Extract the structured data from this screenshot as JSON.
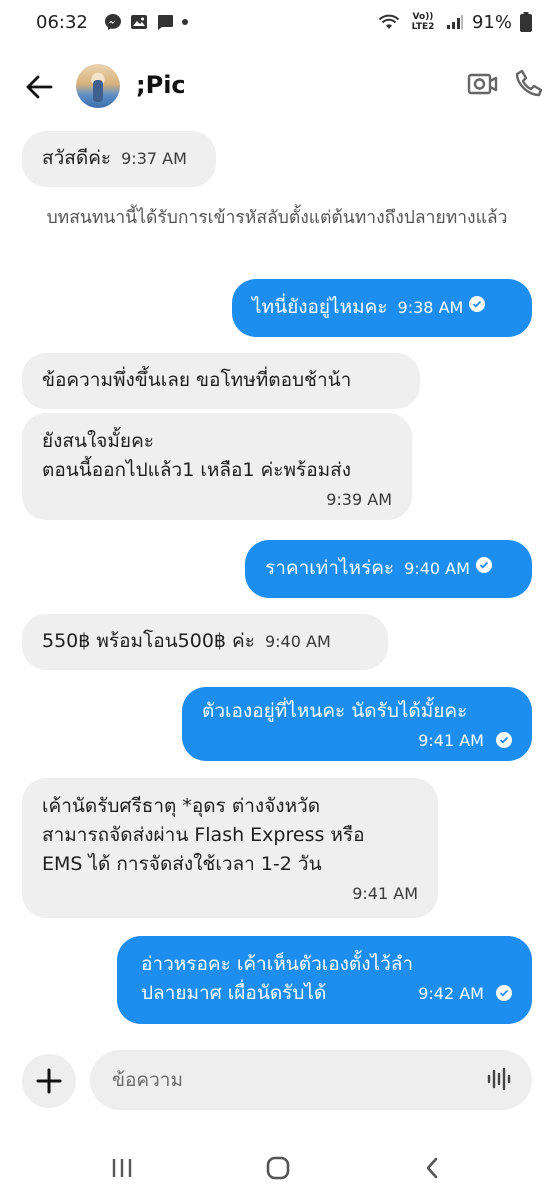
{
  "status_bar": {
    "time": "06:32",
    "signal_label": "Vo)) LTE2",
    "battery": "91%"
  },
  "header": {
    "contact_name": ";Pic"
  },
  "system_note": "บทสนทนานี้ได้รับการเข้ารหัสลับตั้งแต่ต้นทางถึงปลายทางแล้ว",
  "messages": [
    {
      "direction": "in",
      "lines": [
        "สวัสดีค่ะ"
      ],
      "time": "9:37 AM"
    },
    {
      "direction": "out",
      "lines": [
        "ไทนี่ยังอยู่ไหมคะ"
      ],
      "time": "9:38 AM"
    },
    {
      "direction": "in",
      "lines": [
        "ข้อความพึ่งขึ้นเลย ขอโทษที่ตอบช้าน้า"
      ],
      "time": ""
    },
    {
      "direction": "in",
      "lines": [
        "ยังสนใจมั้ยคะ",
        "ตอนนี้ออกไปแล้ว1 เหลือ1 ค่ะพร้อมส่ง"
      ],
      "time": "9:39 AM"
    },
    {
      "direction": "out",
      "lines": [
        "ราคาเท่าไหร่คะ"
      ],
      "time": "9:40 AM"
    },
    {
      "direction": "in",
      "lines": [
        "550฿ พร้อมโอน500฿ ค่ะ"
      ],
      "time": "9:40 AM"
    },
    {
      "direction": "out",
      "lines": [
        "ตัวเองอยู่ที่ไหนคะ นัดรับได้มั้ยคะ"
      ],
      "time": "9:41 AM"
    },
    {
      "direction": "in",
      "lines": [
        "เค้านัดรับศรีธาตุ *อุดร  ต่างจังหวัด",
        "สามารถจัดส่งผ่าน Flash Express หรือ",
        "EMS ได้ การจัดส่งใช้เวลา 1-2 วัน"
      ],
      "time": "9:41 AM"
    },
    {
      "direction": "out",
      "lines": [
        "อ่าวหรอคะ เค้าเห็นตัวเองตั้งไว้ลำ",
        "ปลายมาศ เผื่อนัดรับได้"
      ],
      "time": "9:42 AM"
    }
  ],
  "composer": {
    "placeholder": "ข้อความ"
  },
  "icons": {
    "back": "arrow-left-icon",
    "video": "video-camera-icon",
    "call": "phone-icon",
    "plus": "plus-icon",
    "voice": "voice-wave-icon",
    "read": "check-circle-icon"
  },
  "colors": {
    "outgoing_bubble": "#1e8df0",
    "incoming_bubble": "#efefef"
  }
}
